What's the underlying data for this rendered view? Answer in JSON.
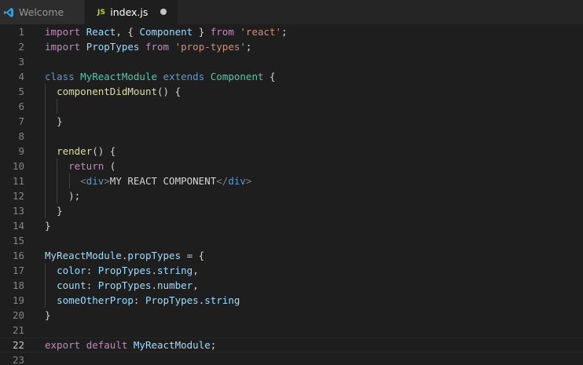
{
  "tabs": [
    {
      "label": "Welcome",
      "icon": "vscode-logo-icon",
      "active": false
    },
    {
      "label": "index.js",
      "icon_text": "JS",
      "active": true,
      "dirty": true
    }
  ],
  "editor": {
    "current_line": 22,
    "lines": [
      {
        "n": "1",
        "tokens": [
          [
            "keyword",
            "import"
          ],
          [
            "text",
            " "
          ],
          [
            "variable",
            "React"
          ],
          [
            "punct",
            ", { "
          ],
          [
            "variable",
            "Component"
          ],
          [
            "punct",
            " } "
          ],
          [
            "keyword",
            "from"
          ],
          [
            "text",
            " "
          ],
          [
            "string",
            "'react'"
          ],
          [
            "punct",
            ";"
          ]
        ]
      },
      {
        "n": "2",
        "tokens": [
          [
            "keyword",
            "import"
          ],
          [
            "text",
            " "
          ],
          [
            "variable",
            "PropTypes"
          ],
          [
            "text",
            " "
          ],
          [
            "keyword",
            "from"
          ],
          [
            "text",
            " "
          ],
          [
            "string",
            "'prop-types'"
          ],
          [
            "punct",
            ";"
          ]
        ]
      },
      {
        "n": "3",
        "tokens": []
      },
      {
        "n": "4",
        "tokens": [
          [
            "storage",
            "class"
          ],
          [
            "text",
            " "
          ],
          [
            "class",
            "MyReactModule"
          ],
          [
            "text",
            " "
          ],
          [
            "storage",
            "extends"
          ],
          [
            "text",
            " "
          ],
          [
            "class",
            "Component"
          ],
          [
            "punct",
            " {"
          ]
        ]
      },
      {
        "n": "5",
        "indent": 1,
        "tokens": [
          [
            "text",
            "  "
          ],
          [
            "function",
            "componentDidMount"
          ],
          [
            "punct",
            "() {"
          ]
        ]
      },
      {
        "n": "6",
        "indent": 2,
        "tokens": []
      },
      {
        "n": "7",
        "indent": 1,
        "tokens": [
          [
            "text",
            "  "
          ],
          [
            "punct",
            "}"
          ]
        ]
      },
      {
        "n": "8",
        "indent": 1,
        "tokens": []
      },
      {
        "n": "9",
        "indent": 1,
        "tokens": [
          [
            "text",
            "  "
          ],
          [
            "function",
            "render"
          ],
          [
            "punct",
            "() {"
          ]
        ]
      },
      {
        "n": "10",
        "indent": 2,
        "tokens": [
          [
            "text",
            "    "
          ],
          [
            "keyword",
            "return"
          ],
          [
            "punct",
            " ("
          ]
        ]
      },
      {
        "n": "11",
        "indent": 3,
        "tokens": [
          [
            "text",
            "      "
          ],
          [
            "tag-bracket",
            "<"
          ],
          [
            "tag",
            "div"
          ],
          [
            "tag-bracket",
            ">"
          ],
          [
            "text",
            "MY REACT COMPONENT"
          ],
          [
            "tag-bracket",
            "</"
          ],
          [
            "tag",
            "div"
          ],
          [
            "tag-bracket",
            ">"
          ]
        ]
      },
      {
        "n": "12",
        "indent": 2,
        "tokens": [
          [
            "text",
            "    "
          ],
          [
            "punct",
            ");"
          ]
        ]
      },
      {
        "n": "13",
        "indent": 1,
        "tokens": [
          [
            "text",
            "  "
          ],
          [
            "punct",
            "}"
          ]
        ]
      },
      {
        "n": "14",
        "tokens": [
          [
            "punct",
            "}"
          ]
        ]
      },
      {
        "n": "15",
        "tokens": []
      },
      {
        "n": "16",
        "tokens": [
          [
            "variable",
            "MyReactModule"
          ],
          [
            "punct",
            "."
          ],
          [
            "variable",
            "propTypes"
          ],
          [
            "punct",
            " = {"
          ]
        ]
      },
      {
        "n": "17",
        "indent": 1,
        "tokens": [
          [
            "text",
            "  "
          ],
          [
            "variable",
            "color"
          ],
          [
            "punct",
            ": "
          ],
          [
            "variable",
            "PropTypes"
          ],
          [
            "punct",
            "."
          ],
          [
            "variable",
            "string"
          ],
          [
            "punct",
            ","
          ]
        ]
      },
      {
        "n": "18",
        "indent": 1,
        "tokens": [
          [
            "text",
            "  "
          ],
          [
            "variable",
            "count"
          ],
          [
            "punct",
            ": "
          ],
          [
            "variable",
            "PropTypes"
          ],
          [
            "punct",
            "."
          ],
          [
            "variable",
            "number"
          ],
          [
            "punct",
            ","
          ]
        ]
      },
      {
        "n": "19",
        "indent": 1,
        "tokens": [
          [
            "text",
            "  "
          ],
          [
            "variable",
            "someOtherProp"
          ],
          [
            "punct",
            ": "
          ],
          [
            "variable",
            "PropTypes"
          ],
          [
            "punct",
            "."
          ],
          [
            "variable",
            "string"
          ]
        ]
      },
      {
        "n": "20",
        "tokens": [
          [
            "punct",
            "}"
          ]
        ]
      },
      {
        "n": "21",
        "tokens": []
      },
      {
        "n": "22",
        "tokens": [
          [
            "keyword",
            "export"
          ],
          [
            "text",
            " "
          ],
          [
            "keyword",
            "default"
          ],
          [
            "text",
            " "
          ],
          [
            "variable",
            "MyReactModule"
          ],
          [
            "punct",
            ";"
          ]
        ]
      },
      {
        "n": "23",
        "tokens": []
      }
    ]
  },
  "colors": {
    "background": "#1e1e1e",
    "tabbar": "#252526",
    "keyword": "#c586c0",
    "storage": "#569cd6",
    "class": "#4ec9b0",
    "variable": "#9cdcfe",
    "function": "#dcdcaa",
    "string": "#ce9178"
  }
}
